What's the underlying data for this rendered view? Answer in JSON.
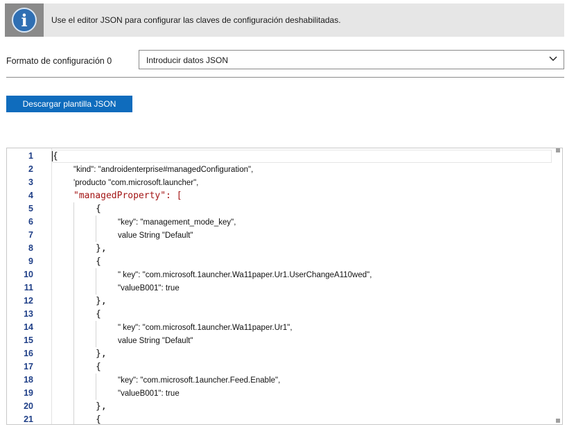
{
  "info_banner": {
    "icon": "info-icon",
    "icon_glyph": "i",
    "text": "Use el editor JSON para configurar las claves de configuración deshabilitadas."
  },
  "format": {
    "label": "Formato de configuración 0",
    "selected": "Introducir datos JSON"
  },
  "download_button": "Descargar plantilla JSON",
  "editor": {
    "line_numbers": [
      "1",
      "2",
      "3",
      "4",
      "5",
      "6",
      "7",
      "8",
      "9",
      "10",
      "11",
      "12",
      "13",
      "14",
      "15",
      "16",
      "17",
      "18",
      "19",
      "20",
      "21"
    ],
    "lines": [
      "{",
      "\"kind\": \"androidenterprise#managedConfiguration\",",
      "'producto \"com.microsoft.launcher\",",
      "\"managedProperty\": [",
      "{",
      "\"key\": \"management_mode_key\",",
      "value String \"Default\"",
      "},",
      "{",
      "\" key\": \"com.microsoft.1auncher.Wa11paper.Ur1.UserChangeA110wed\",",
      "\"valueB001\": true",
      "},",
      "{",
      "\" key\": \"com.microsoft.1auncher.Wa11paper.Ur1\",",
      "value String \"Default\"",
      "},",
      "{",
      "\"key\": \"com.microsoft.1auncher.Feed.Enable\",",
      "\"valueB001\": true",
      "},",
      "{"
    ]
  },
  "colors": {
    "accent": "#0f6cbd",
    "banner_bg": "#e6e6e6",
    "icon_bg": "#8a8a8a",
    "line_number": "#1f3f87",
    "json_key": "#a31515"
  }
}
